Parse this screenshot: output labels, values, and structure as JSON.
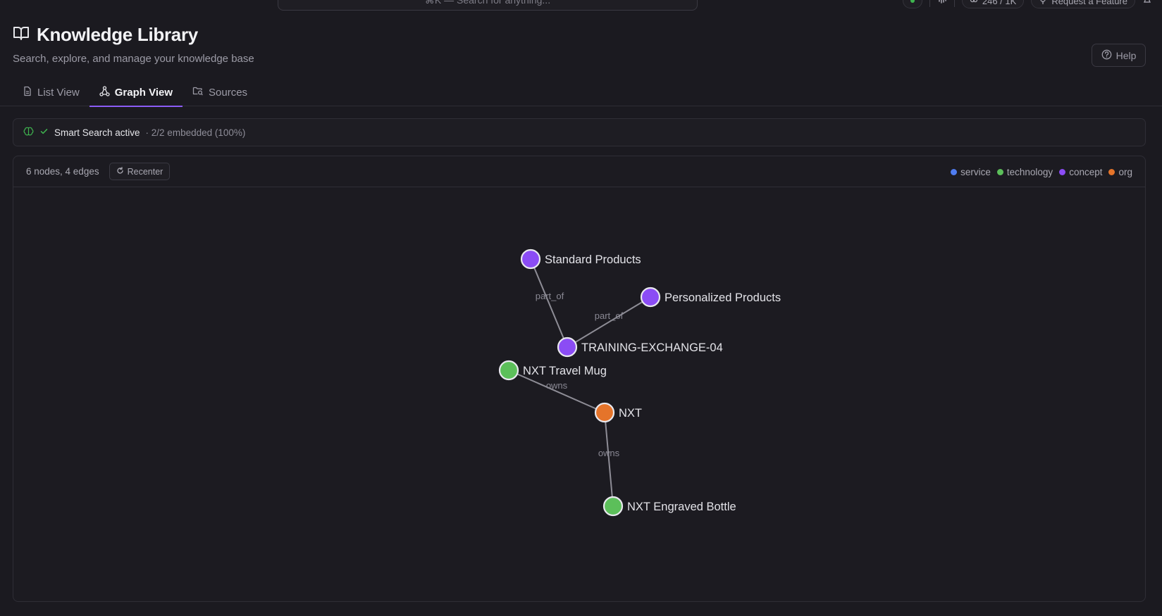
{
  "topbar": {
    "search_placeholder": "⌘K — Search for anything...",
    "usage": "246 / 1K",
    "request_feature": "Request a Feature"
  },
  "header": {
    "title": "Knowledge Library",
    "subtitle": "Search, explore, and manage your knowledge base",
    "help_label": "Help"
  },
  "tabs": [
    {
      "label": "List View",
      "icon": "document-icon",
      "active": false
    },
    {
      "label": "Graph View",
      "icon": "graph-icon",
      "active": true
    },
    {
      "label": "Sources",
      "icon": "folder-icon",
      "active": false
    }
  ],
  "smart_search": {
    "label": "Smart Search active",
    "detail": "· 2/2 embedded (100%)"
  },
  "graph": {
    "summary": "6 nodes, 4 edges",
    "recenter_label": "Recenter",
    "legend": [
      {
        "label": "service",
        "color": "#4f7cf0"
      },
      {
        "label": "technology",
        "color": "#5cbf5a"
      },
      {
        "label": "concept",
        "color": "#8b4cf5"
      },
      {
        "label": "org",
        "color": "#e5742a"
      }
    ],
    "nodes": [
      {
        "id": "standard",
        "label": "Standard Products",
        "type": "concept"
      },
      {
        "id": "personalized",
        "label": "Personalized Products",
        "type": "concept"
      },
      {
        "id": "training",
        "label": "TRAINING-EXCHANGE-04",
        "type": "concept"
      },
      {
        "id": "mug",
        "label": "NXT Travel Mug",
        "type": "technology"
      },
      {
        "id": "nxt",
        "label": "NXT",
        "type": "org"
      },
      {
        "id": "bottle",
        "label": "NXT Engraved Bottle",
        "type": "technology"
      }
    ],
    "edges": [
      {
        "source": "training",
        "target": "standard",
        "label": "part_of"
      },
      {
        "source": "training",
        "target": "personalized",
        "label": "part_of"
      },
      {
        "source": "nxt",
        "target": "mug",
        "label": "owns"
      },
      {
        "source": "nxt",
        "target": "bottle",
        "label": "owns"
      }
    ]
  }
}
